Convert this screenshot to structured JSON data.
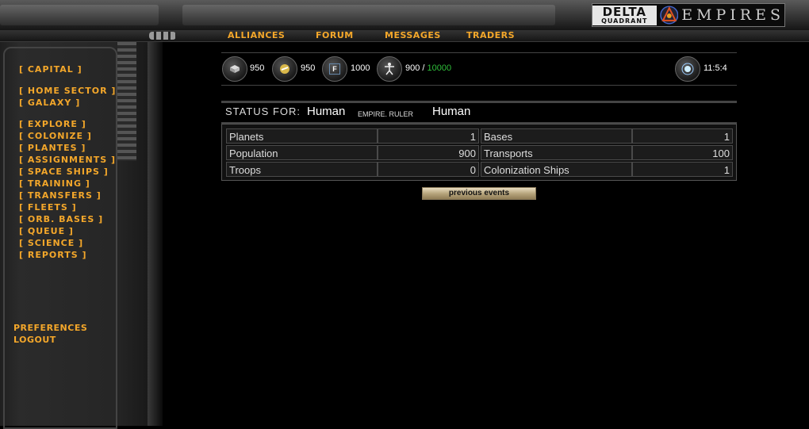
{
  "logo": {
    "delta_top": "DELTA",
    "delta_bottom": "QUADRANT",
    "empires": "EMPIRES"
  },
  "nav": {
    "alliances": "ALLIANCES",
    "forum": "FORUM",
    "messages": "MESSAGES",
    "traders": "TRADERS"
  },
  "sidebar": {
    "capital": "[ CAPITAL ]",
    "home_sector": "[ HOME SECTOR ]",
    "galaxy": "[ GALAXY ]",
    "explore": "[ EXPLORE ]",
    "colonize": "[ COLONIZE ]",
    "plantes": "[ PLANTES ]",
    "assignments": "[ ASSIGNMENTS ]",
    "space_ships": "[ SPACE SHIPS ]",
    "training": "[ TRAINING ]",
    "transfers": "[ TRANSFERS ]",
    "fleets": "[ FLEETS ]",
    "orb_bases": "[ ORB. BASES ]",
    "queue": "[ QUEUE ]",
    "science": "[ SCIENCE ]",
    "reports": "[ REPORTS ]",
    "preferences": "PREFERENCES",
    "logout": "LOGOUT"
  },
  "resources": {
    "metal": "950",
    "crystal": "950",
    "fuel": "1000",
    "fuel_icon_letter": "F",
    "population": "900",
    "population_separator": "/",
    "population_max": "10000",
    "time": "11:5:4"
  },
  "status": {
    "label": "STATUS FOR:",
    "empire_name": "Human",
    "empire_label": "EMPIRE. RULER",
    "ruler_name": "Human"
  },
  "stats": {
    "rows": [
      {
        "left_label": "Planets",
        "left_value": "1",
        "right_label": "Bases",
        "right_value": "1"
      },
      {
        "left_label": "Population",
        "left_value": "900",
        "right_label": "Transports",
        "right_value": "100"
      },
      {
        "left_label": "Troops",
        "left_value": "0",
        "right_label": "Colonization Ships",
        "right_value": "1"
      }
    ]
  },
  "buttons": {
    "previous_events": "previous events"
  },
  "colors": {
    "accent": "#f4a72a",
    "population_max": "#2fbf3a",
    "background": "#000000"
  }
}
